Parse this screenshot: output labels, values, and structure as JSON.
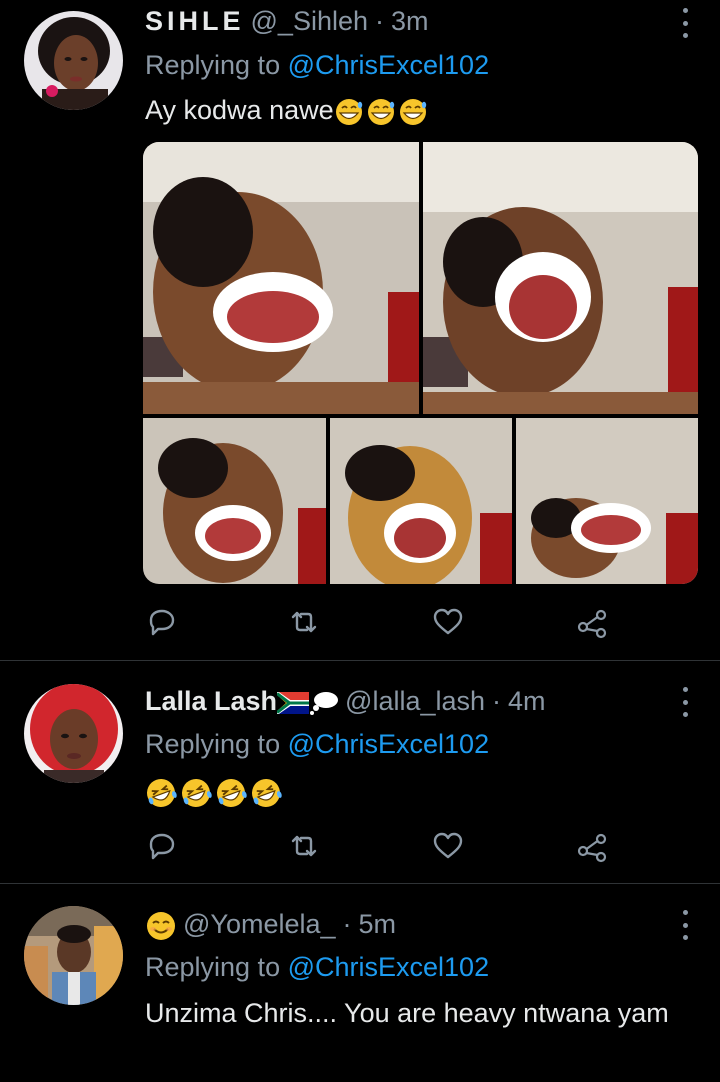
{
  "tweets": [
    {
      "display_name": "SIHLE",
      "handle": "@_Sihleh",
      "separator": "·",
      "time": "3m",
      "replying_prefix": "Replying to ",
      "replying_mention": "@ChrisExcel102",
      "text": "Ay kodwa nawe",
      "text_emoji": "grinning-sweat-emoji x3",
      "media_count": 5
    },
    {
      "display_name": "Lalla Lash",
      "name_emoji": "south-africa-flag-emoji, thought-bubble-emoji",
      "handle": "@lalla_lash",
      "separator": "·",
      "time": "4m",
      "replying_prefix": "Replying to ",
      "replying_mention": "@ChrisExcel102",
      "text_emoji": "rolling-laughing-emoji x4"
    },
    {
      "name_emoji": "smiling-face-emoji",
      "handle": "@Yomelela_",
      "separator": "·",
      "time": "5m",
      "replying_prefix": "Replying to ",
      "replying_mention": "@ChrisExcel102",
      "text": "Unzima Chris.... You are heavy ntwana yam"
    }
  ],
  "icons": {
    "reply": "reply-icon",
    "retweet": "retweet-icon",
    "like": "like-icon",
    "share": "share-icon",
    "more": "more-icon"
  },
  "colors": {
    "background": "#000000",
    "text": "#e7e9ea",
    "secondary": "#8b98a5",
    "mention": "#1d9bf0",
    "divider": "#2f3336"
  }
}
